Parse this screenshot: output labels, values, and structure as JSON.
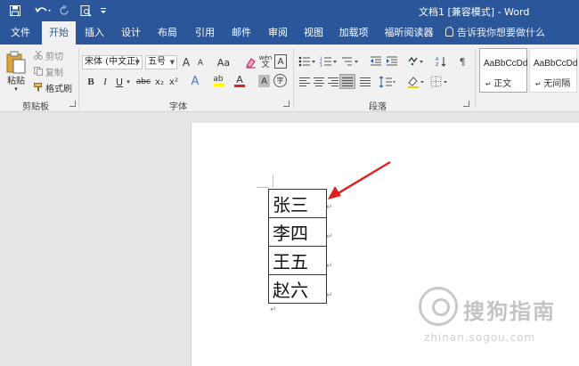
{
  "title_bar": {
    "title": "文档1 [兼容模式] - Word",
    "background": "#2b579a"
  },
  "quick_access": {
    "save_icon": "save-icon",
    "undo_icon": "undo-icon",
    "redo_icon": "redo-icon",
    "print_preview_icon": "print-preview-icon",
    "customize_icon": "customize-qat-icon"
  },
  "tabs": [
    {
      "label": "文件"
    },
    {
      "label": "开始",
      "active": true
    },
    {
      "label": "插入"
    },
    {
      "label": "设计"
    },
    {
      "label": "布局"
    },
    {
      "label": "引用"
    },
    {
      "label": "邮件"
    },
    {
      "label": "审阅"
    },
    {
      "label": "视图"
    },
    {
      "label": "加载项"
    },
    {
      "label": "福昕阅读器"
    }
  ],
  "tell_me": "告诉我你想要做什么",
  "clipboard": {
    "paste": "粘贴",
    "cut": "剪切",
    "copy": "复制",
    "format_painter": "格式刷",
    "group_label": "剪贴板"
  },
  "font": {
    "font_name": "宋体 (中文正)",
    "font_size": "五号",
    "group_label": "字体",
    "grow_label": "A",
    "shrink_label": "A",
    "case_label": "Aa",
    "bold": "B",
    "italic": "I",
    "underline": "U",
    "strike": "abc",
    "subscript": "x₂",
    "superscript": "x²",
    "phonetic": "wén",
    "text_effects": "A",
    "highlight": "ab",
    "font_color": "A",
    "char_shading": "A",
    "enclose": "字",
    "border_char": "A"
  },
  "paragraph": {
    "group_label": "段落"
  },
  "styles": [
    {
      "preview": "AaBbCcDd",
      "name": "正文",
      "selected": true
    },
    {
      "preview": "AaBbCcDd",
      "name": "无间隔",
      "selected": false
    }
  ],
  "document": {
    "table_rows": [
      "张三",
      "李四",
      "王五",
      "赵六"
    ],
    "cell_mark": "↵",
    "paragraph_mark": "↵"
  },
  "annotation": {
    "arrow_color": "#e02020"
  },
  "watermark": {
    "text": "搜狗指南",
    "url": "zhinan.sogou.com"
  }
}
